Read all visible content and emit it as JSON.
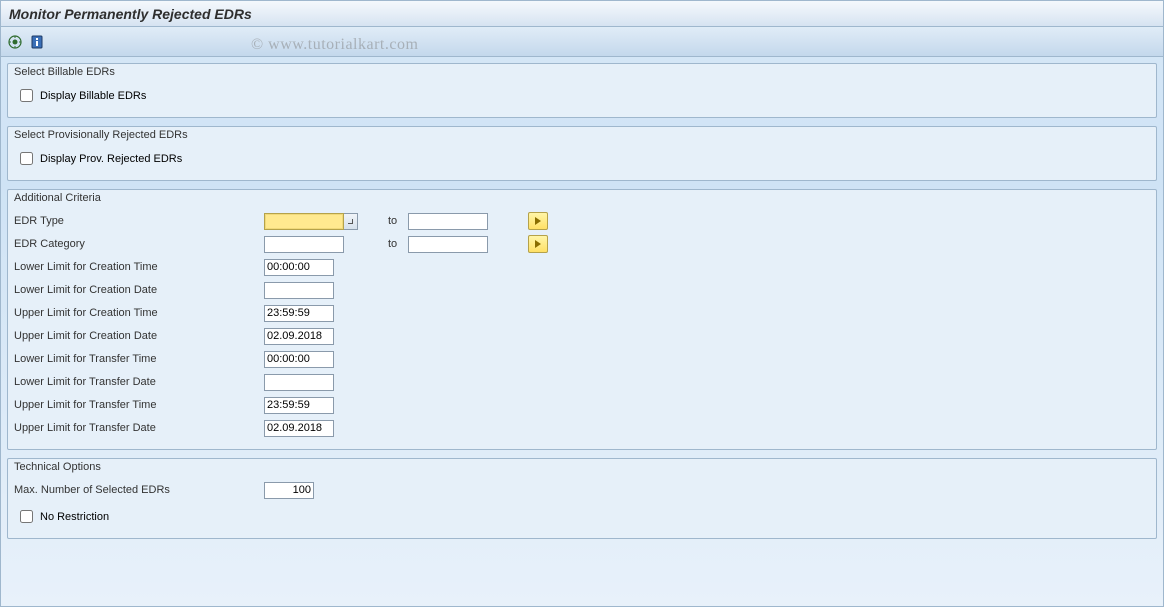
{
  "window": {
    "title": "Monitor Permanently Rejected EDRs"
  },
  "watermark": "© www.tutorialkart.com",
  "groups": {
    "billable": {
      "title": "Select Billable EDRs",
      "checkbox_label": "Display Billable EDRs"
    },
    "provisional": {
      "title": "Select Provisionally Rejected EDRs",
      "checkbox_label": "Display Prov. Rejected EDRs"
    },
    "criteria": {
      "title": "Additional Criteria",
      "edr_type": {
        "label": "EDR Type",
        "from": "",
        "to_label": "to",
        "to": ""
      },
      "edr_category": {
        "label": "EDR Category",
        "from": "",
        "to_label": "to",
        "to": ""
      },
      "lower_creation_time": {
        "label": "Lower Limit for Creation Time",
        "value": "00:00:00"
      },
      "lower_creation_date": {
        "label": "Lower Limit for Creation Date",
        "value": ""
      },
      "upper_creation_time": {
        "label": "Upper Limit for Creation Time",
        "value": "23:59:59"
      },
      "upper_creation_date": {
        "label": "Upper Limit for Creation Date",
        "value": "02.09.2018"
      },
      "lower_transfer_time": {
        "label": "Lower Limit for Transfer Time",
        "value": "00:00:00"
      },
      "lower_transfer_date": {
        "label": "Lower Limit for Transfer Date",
        "value": ""
      },
      "upper_transfer_time": {
        "label": "Upper Limit for Transfer Time",
        "value": "23:59:59"
      },
      "upper_transfer_date": {
        "label": "Upper Limit for Transfer Date",
        "value": "02.09.2018"
      }
    },
    "technical": {
      "title": "Technical Options",
      "max_edrs": {
        "label": "Max. Number of Selected EDRs",
        "value": "100"
      },
      "no_restriction_label": "No Restriction"
    }
  }
}
